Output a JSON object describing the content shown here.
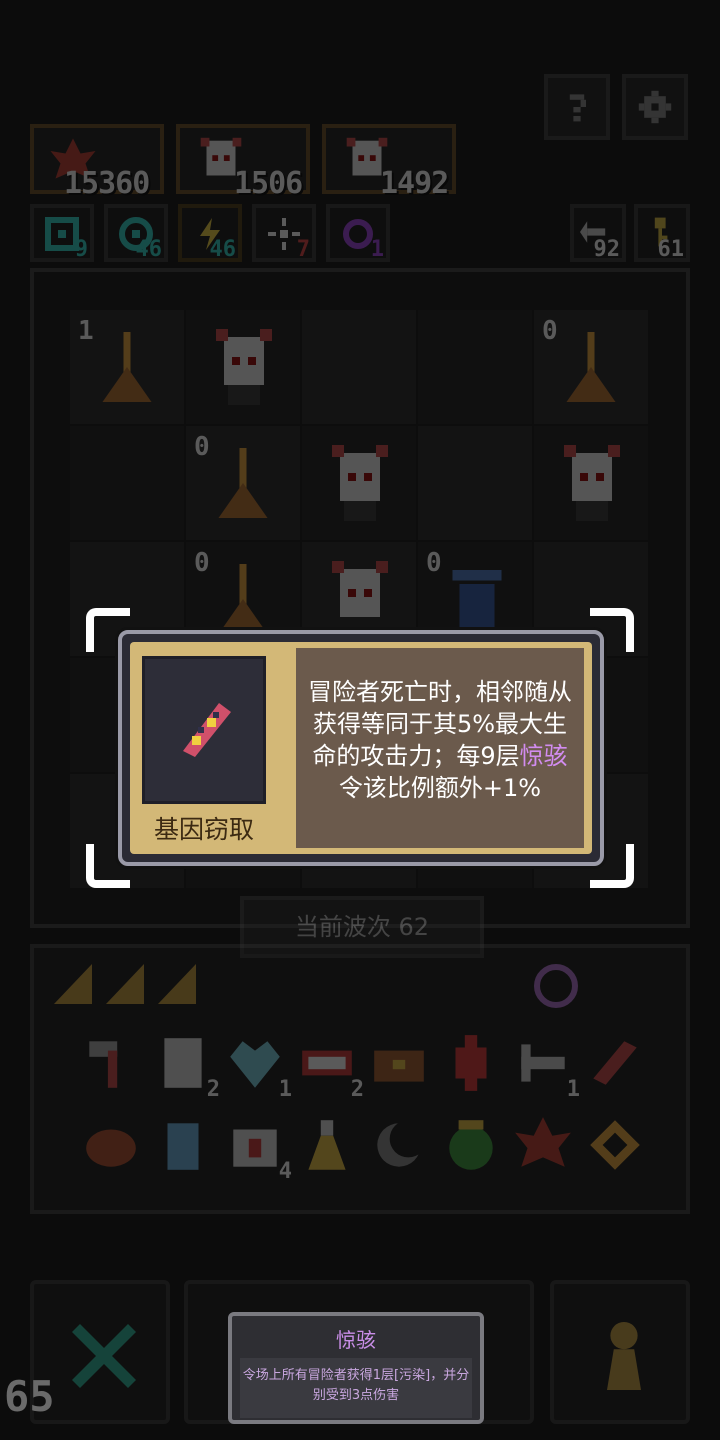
{
  "resources": [
    {
      "icon": "maple-leaf-icon",
      "value": "15360"
    },
    {
      "icon": "adventurer-portrait-icon",
      "value": "1506"
    },
    {
      "icon": "adventurer-portrait-icon",
      "value": "1492"
    }
  ],
  "stats": [
    {
      "icon": "cyan-swirl-icon",
      "value": "9",
      "color": "#2bd3c8"
    },
    {
      "icon": "cyan-eye-icon",
      "value": "46",
      "color": "#2bd3c8"
    },
    {
      "icon": "lightning-icon",
      "value": "46",
      "color": "#f0d040"
    },
    {
      "icon": "light-icon",
      "value": "7",
      "color": "#e04040"
    },
    {
      "icon": "purple-orb-icon",
      "value": "1",
      "color": "#a040e0"
    }
  ],
  "counters": [
    {
      "icon": "return-arrow-icon",
      "value": "92"
    },
    {
      "icon": "key-icon",
      "value": "61"
    }
  ],
  "board": {
    "levels": [
      "1",
      "0",
      "0",
      "0",
      "0"
    ]
  },
  "wave": {
    "label": "当前波次 62"
  },
  "inventory_counts": [
    "2",
    "1",
    "2",
    "1",
    "4"
  ],
  "card": {
    "name": "基因窃取",
    "desc_part1": "冒险者死亡时，相邻随从获得等同于其5%最大生命的攻击力；每9层",
    "desc_highlight": "惊骇",
    "desc_part2": "令该比例额外+1%"
  },
  "tooltip": {
    "title": "惊骇",
    "body": "令场上所有冒险者获得1层[污染]，并分别受到3点伤害"
  },
  "wave_big": "65",
  "colors": {
    "accent": "#d3b877",
    "highlight": "#d28cf0",
    "desc_bg": "#6b5a4c"
  }
}
